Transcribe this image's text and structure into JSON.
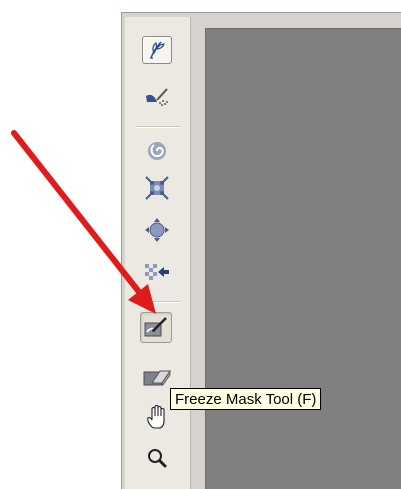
{
  "toolbar": {
    "tools": [
      {
        "name": "forward-warp-tool",
        "icon": "warp-feather-icon",
        "state": "selected"
      },
      {
        "name": "reconstruct-tool",
        "icon": "reconstruct-brush-icon",
        "state": "normal"
      },
      {
        "name": "twirl-clockwise-tool",
        "icon": "twirl-icon",
        "state": "normal"
      },
      {
        "name": "pucker-tool",
        "icon": "pucker-icon",
        "state": "normal"
      },
      {
        "name": "bloat-tool",
        "icon": "bloat-icon",
        "state": "normal"
      },
      {
        "name": "push-left-tool",
        "icon": "push-left-icon",
        "state": "normal"
      },
      {
        "name": "freeze-mask-tool",
        "icon": "freeze-mask-icon",
        "state": "pressed"
      },
      {
        "name": "thaw-mask-tool",
        "icon": "thaw-mask-icon",
        "state": "normal"
      },
      {
        "name": "hand-tool",
        "icon": "hand-icon",
        "state": "normal"
      },
      {
        "name": "zoom-tool",
        "icon": "magnifier-icon",
        "state": "normal"
      }
    ]
  },
  "tooltip": {
    "text": "Freeze Mask Tool (F)"
  },
  "colors": {
    "arrow": "#e01b1b",
    "canvas": "#808080",
    "tooltip_bg": "#ffffe1",
    "panel_bg": "#ebe9e2"
  }
}
